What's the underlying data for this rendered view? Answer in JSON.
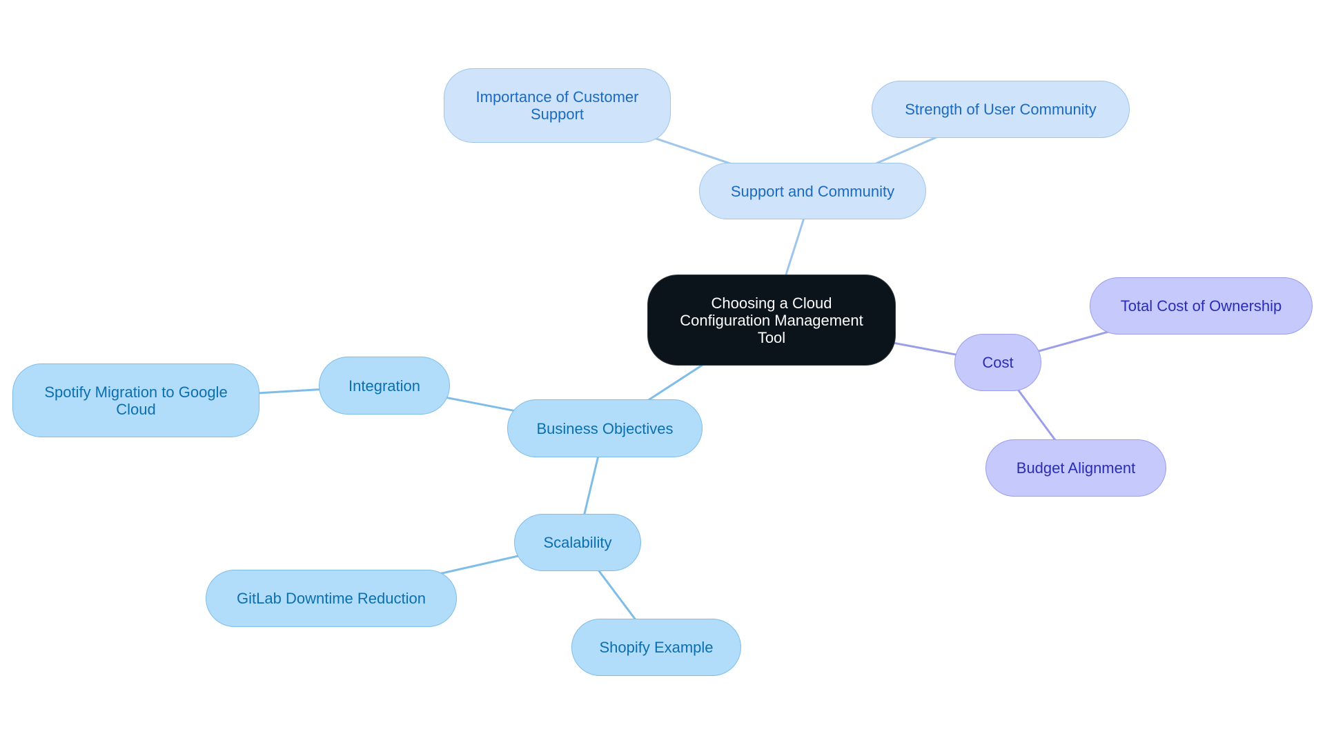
{
  "diagram": {
    "type": "mindmap",
    "colors": {
      "root_fill": "#0b131b",
      "root_text": "#ffffff",
      "support_fill": "#cfe3fb",
      "support_stroke": "#9ec5ec",
      "support_text": "#1b6ac0",
      "business_fill": "#b1ddfb",
      "business_stroke": "#7ebde8",
      "business_text": "#0b6fae",
      "cost_fill": "#c6c9fc",
      "cost_stroke": "#9b9ee8",
      "cost_text": "#2a2db3"
    },
    "nodes": {
      "root": {
        "label": "Choosing a Cloud Configuration Management Tool",
        "branch": "root"
      },
      "support": {
        "label": "Support and Community",
        "branch": "support"
      },
      "customer_support": {
        "label": "Importance of Customer Support",
        "branch": "support"
      },
      "user_community": {
        "label": "Strength of User Community",
        "branch": "support"
      },
      "cost": {
        "label": "Cost",
        "branch": "cost"
      },
      "tco": {
        "label": "Total Cost of Ownership",
        "branch": "cost"
      },
      "budget": {
        "label": "Budget Alignment",
        "branch": "cost"
      },
      "business": {
        "label": "Business Objectives",
        "branch": "business"
      },
      "integration": {
        "label": "Integration",
        "branch": "business"
      },
      "spotify": {
        "label": "Spotify Migration to Google Cloud",
        "branch": "business"
      },
      "scalability": {
        "label": "Scalability",
        "branch": "business"
      },
      "gitlab": {
        "label": "GitLab Downtime Reduction",
        "branch": "business"
      },
      "shopify": {
        "label": "Shopify Example",
        "branch": "business"
      }
    },
    "edges": [
      {
        "from": "root",
        "to": "support"
      },
      {
        "from": "support",
        "to": "customer_support"
      },
      {
        "from": "support",
        "to": "user_community"
      },
      {
        "from": "root",
        "to": "cost"
      },
      {
        "from": "cost",
        "to": "tco"
      },
      {
        "from": "cost",
        "to": "budget"
      },
      {
        "from": "root",
        "to": "business"
      },
      {
        "from": "business",
        "to": "integration"
      },
      {
        "from": "integration",
        "to": "spotify"
      },
      {
        "from": "business",
        "to": "scalability"
      },
      {
        "from": "scalability",
        "to": "gitlab"
      },
      {
        "from": "scalability",
        "to": "shopify"
      }
    ]
  }
}
